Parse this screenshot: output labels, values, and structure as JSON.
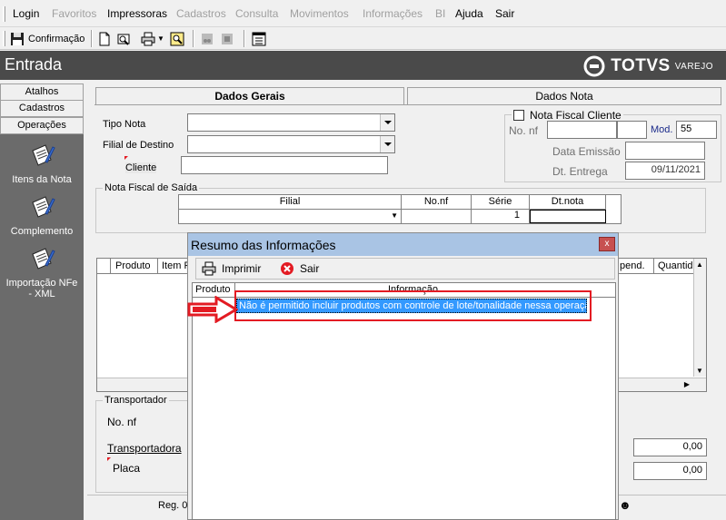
{
  "menu": {
    "items": [
      {
        "label": "Login",
        "enabled": true
      },
      {
        "label": "Favoritos",
        "enabled": false
      },
      {
        "label": "Impressoras",
        "enabled": true
      },
      {
        "label": "Cadastros",
        "enabled": false
      },
      {
        "label": "Consulta",
        "enabled": false
      },
      {
        "label": "Movimentos",
        "enabled": false
      },
      {
        "label": "Informações",
        "enabled": false
      },
      {
        "label": "BI",
        "enabled": false
      },
      {
        "label": "Ajuda",
        "enabled": true
      },
      {
        "label": "Sair",
        "enabled": true
      }
    ]
  },
  "toolbar": {
    "confirm_label": "Confirmação"
  },
  "window": {
    "title": "Entrada",
    "brand": "TOTVS",
    "brand_sub": "VAREJO"
  },
  "sidebar": {
    "buttons": [
      "Atalhos",
      "Cadastros",
      "Operações"
    ],
    "shortcuts": [
      "Itens da Nota",
      "Complemento",
      "Importação NFe - XML"
    ]
  },
  "tabs": {
    "general": "Dados Gerais",
    "note": "Dados Nota"
  },
  "general": {
    "tipo_nota_label": "Tipo Nota",
    "tipo_nota_value": "",
    "filial_destino_label": "Filial de Destino",
    "filial_destino_value": "",
    "cliente_label": "Cliente",
    "cliente_value": ""
  },
  "note_data": {
    "checkbox_label": "Nota Fiscal Cliente",
    "checkbox_checked": false,
    "no_nf_label": "No. nf",
    "no_nf_value": "",
    "mod_label": "Mod.",
    "mod_value": "55",
    "data_emissao_label": "Data Emissão",
    "data_emissao_value": "",
    "dt_entrega_label": "Dt. Entrega",
    "dt_entrega_value": "09/11/2021"
  },
  "nf_saida": {
    "group_title": "Nota Fiscal de Saída",
    "columns": [
      "Filial",
      "No.nf",
      "Série",
      "Dt.nota"
    ],
    "row": {
      "filial": "",
      "no_nf": "",
      "serie": "1",
      "dt_nota": ""
    }
  },
  "items_grid": {
    "columns_left": [
      "Produto",
      "Item F"
    ],
    "columns_right": [
      "pend.",
      "Quantida"
    ]
  },
  "transport": {
    "group_title": "Transportador",
    "no_nf_label": "No. nf",
    "transportadora_label": "Transportadora",
    "placa_label": "Placa",
    "value1": "0,00",
    "value2": "0,00"
  },
  "statusbar": {
    "reg_label": "Reg. 0"
  },
  "dialog": {
    "title": "Resumo das Informações",
    "close_label": "x",
    "print_label": "Imprimir",
    "exit_label": "Sair",
    "columns": [
      "Produto",
      "Informação"
    ],
    "rows": [
      {
        "produto": "",
        "informacao": "Não é permitido incluir produtos com controle de lote/tonalidade nessa operação"
      }
    ]
  },
  "colors": {
    "highlight": "#3399ff",
    "annotation": "#e31b23",
    "titlebar": "#4a4a4a",
    "sidebar": "#6b6b6b"
  }
}
